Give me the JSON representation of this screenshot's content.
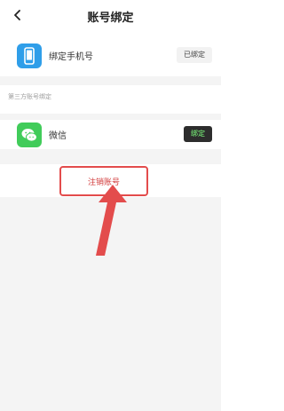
{
  "colors": {
    "phone_icon_bg": "#2f9ee9",
    "wechat_icon_bg": "#41cc5a",
    "highlight_red": "#e34c4c",
    "bind_button_bg": "#2d2d2d",
    "bind_button_text": "#7dff7d"
  },
  "header": {
    "title": "账号绑定",
    "back_icon": "chevron-left-icon"
  },
  "phone_row": {
    "label": "绑定手机号",
    "status": "已绑定",
    "icon": "phone-icon"
  },
  "third_party": {
    "section_title": "第三方账号绑定",
    "wechat_label": "微信",
    "bind_label": "绑定",
    "icon": "wechat-icon"
  },
  "actions": {
    "cancel_account": "注销账号"
  }
}
